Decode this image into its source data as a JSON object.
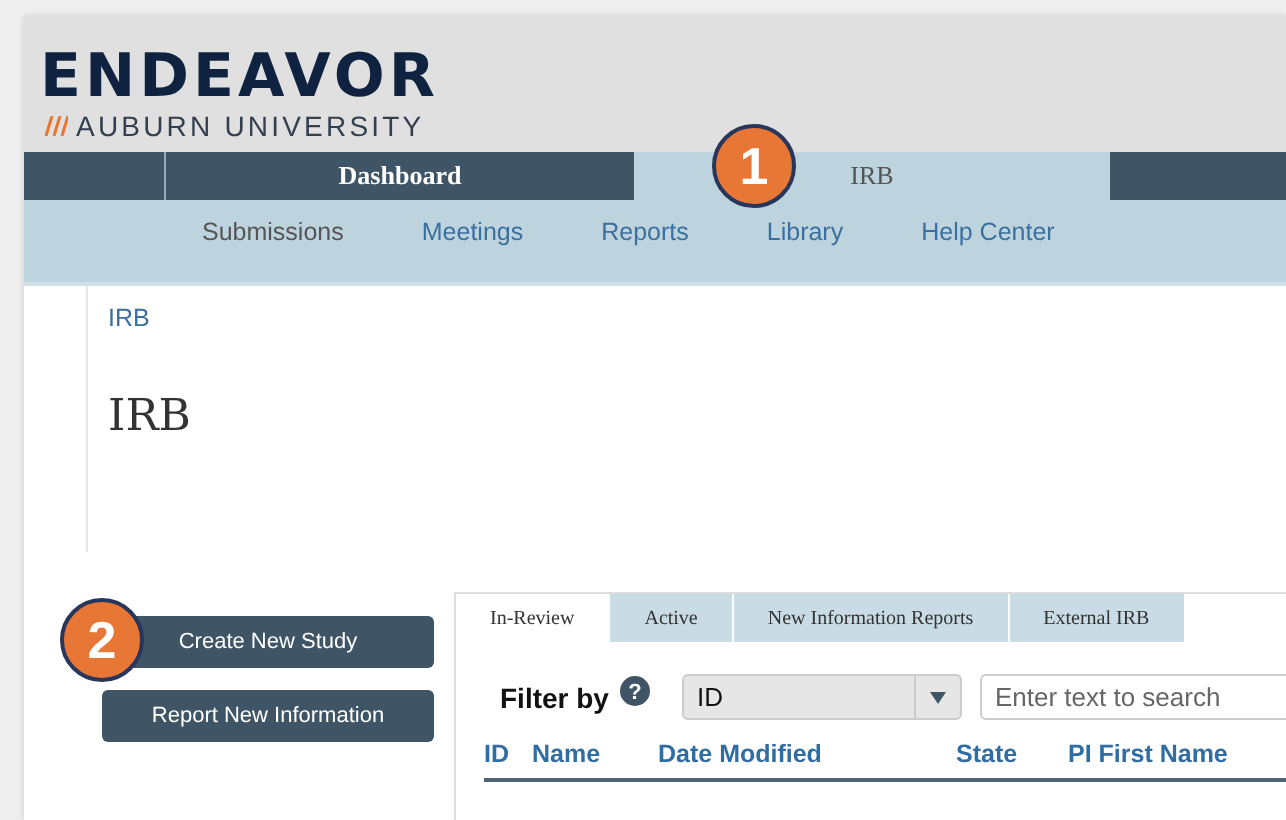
{
  "logo": {
    "title": "ENDEAVOR",
    "subtitle": "AUBURN UNIVERSITY"
  },
  "nav": [
    {
      "label": "Dashboard",
      "selected": false
    },
    {
      "label": "IRB",
      "selected": true
    }
  ],
  "subnav": [
    {
      "label": "Submissions",
      "selected": true
    },
    {
      "label": "Meetings",
      "selected": false
    },
    {
      "label": "Reports",
      "selected": false
    },
    {
      "label": "Library",
      "selected": false
    },
    {
      "label": "Help Center",
      "selected": false
    }
  ],
  "breadcrumb": "IRB",
  "page_title": "IRB",
  "actions": [
    "Create New Study",
    "Report New Information"
  ],
  "tabs": [
    {
      "label": "In-Review",
      "selected": true
    },
    {
      "label": "Active",
      "selected": false
    },
    {
      "label": "New Information Reports",
      "selected": false
    },
    {
      "label": "External IRB",
      "selected": false
    }
  ],
  "filter": {
    "label": "Filter by",
    "help": "?",
    "field": "ID",
    "search_placeholder": "Enter text to search"
  },
  "table": {
    "columns": [
      "ID",
      "Name",
      "Date Modified",
      "State",
      "PI First Name"
    ]
  },
  "callouts": [
    "1",
    "2"
  ]
}
